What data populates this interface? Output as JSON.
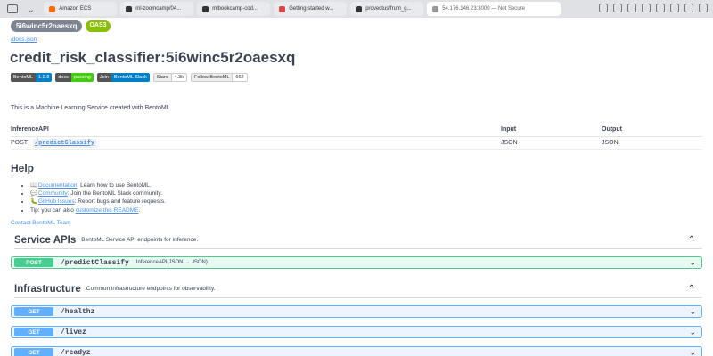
{
  "browser": {
    "tabs": [
      {
        "label": "Amazon ECS",
        "color": "#ff6d00"
      },
      {
        "label": "ml-zoomcamp/04...",
        "color": "#333333"
      },
      {
        "label": "mlbookcamp-cod...",
        "color": "#333333"
      },
      {
        "label": "Getting started w...",
        "color": "#d44"
      },
      {
        "label": "provectus/frum_g...",
        "color": "#333333"
      },
      {
        "label": "54.176.146.23:3000 — Not Secure",
        "color": "#999999",
        "active": true
      }
    ]
  },
  "header": {
    "badge_title": "5i6winc5r2oaesxq",
    "badge_oas": "OAS3",
    "docs_link": "/docs.json",
    "title": "credit_risk_classifier:5i6winc5r2oaesxq"
  },
  "shields": [
    {
      "left": "BentoML",
      "right": "1.0.8",
      "color": "#007ec6"
    },
    {
      "left": "docs",
      "right": "passing",
      "color": "#4c1"
    },
    {
      "left": "Join",
      "right": "BentoML Slack",
      "color": "#007ec6"
    },
    {
      "left": "Stars",
      "right": "4.3k",
      "plain": true
    },
    {
      "left": "Follow BentoML",
      "right": "662",
      "plain": true
    }
  ],
  "description": "This is a Machine Learning Service created with BentoML.",
  "api_table": {
    "headers": [
      "InferenceAPI",
      "Input",
      "Output"
    ],
    "rows": [
      {
        "method": "POST",
        "path": "/predictClassify",
        "input": "JSON",
        "output": "JSON"
      }
    ]
  },
  "help": {
    "title": "Help",
    "items": [
      {
        "icon": "📖",
        "link": "Documentation",
        "text": ": Learn how to use BentoML."
      },
      {
        "icon": "💬",
        "link": "Community",
        "text": ": Join the BentoML Slack community."
      },
      {
        "icon": "🐛",
        "link": "GitHub Issues",
        "text": ": Report bugs and feature requests."
      },
      {
        "icon": "",
        "prefix": "Tip: you can also ",
        "link": "customize this README",
        "text": "."
      }
    ],
    "contact": "Contact BentoML Team"
  },
  "service_apis": {
    "title": "Service APIs",
    "description": "BentoML Service API endpoints for inference.",
    "ops": [
      {
        "method": "POST",
        "path": "/predictClassify",
        "desc": "InferenceAPI(JSON → JSON)"
      }
    ]
  },
  "infrastructure": {
    "title": "Infrastructure",
    "description": "Common infrastructure endpoints for observability.",
    "ops": [
      {
        "method": "GET",
        "path": "/healthz"
      },
      {
        "method": "GET",
        "path": "/livez"
      },
      {
        "method": "GET",
        "path": "/readyz"
      }
    ]
  }
}
